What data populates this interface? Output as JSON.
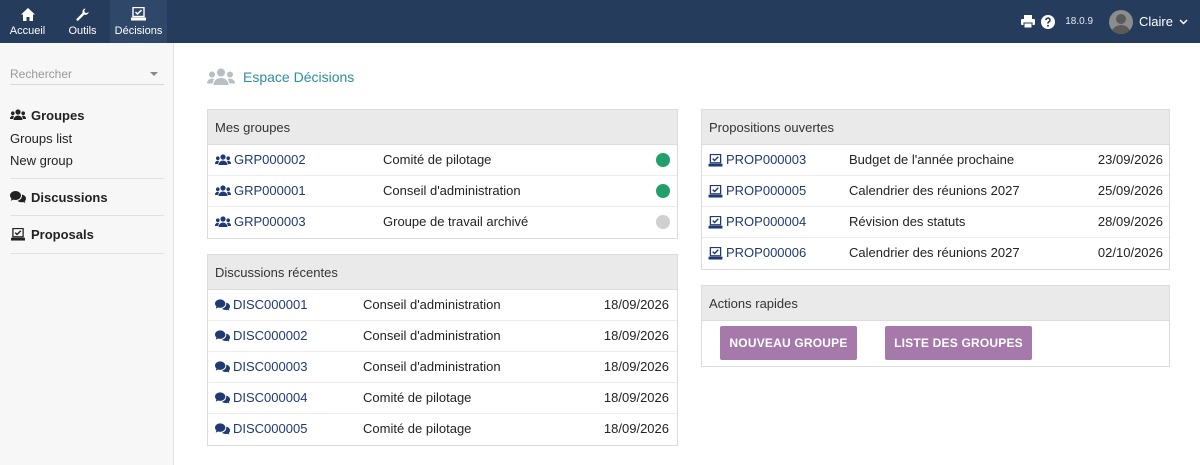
{
  "topnav": {
    "items": [
      {
        "label": "Accueil",
        "icon": "home-icon"
      },
      {
        "label": "Outils",
        "icon": "wrench-icon"
      },
      {
        "label": "Décisions",
        "icon": "vote-icon"
      }
    ],
    "version": "18.0.9",
    "user": "Claire",
    "bar_color": "#263c5c"
  },
  "sidebar": {
    "search_placeholder": "Rechercher",
    "groups_heading": "Groupes",
    "groups_items": [
      "Groups list",
      "New group"
    ],
    "discussions_heading": "Discussions",
    "proposals_heading": "Proposals"
  },
  "main": {
    "title": "Espace Décisions",
    "mes_groupes": {
      "title": "Mes groupes",
      "rows": [
        {
          "ref": "GRP000002",
          "name": "Comité de pilotage",
          "status": "active",
          "status_color": "#22a06b"
        },
        {
          "ref": "GRP000001",
          "name": "Conseil d'administration",
          "status": "active",
          "status_color": "#22a06b"
        },
        {
          "ref": "GRP000003",
          "name": "Groupe de travail archivé",
          "status": "archived",
          "status_color": "#d0d0d0"
        }
      ]
    },
    "discussions": {
      "title": "Discussions récentes",
      "rows": [
        {
          "ref": "DISC000001",
          "group": "Conseil d'administration",
          "date": "18/09/2026"
        },
        {
          "ref": "DISC000002",
          "group": "Conseil d'administration",
          "date": "18/09/2026"
        },
        {
          "ref": "DISC000003",
          "group": "Conseil d'administration",
          "date": "18/09/2026"
        },
        {
          "ref": "DISC000004",
          "group": "Comité de pilotage",
          "date": "18/09/2026"
        },
        {
          "ref": "DISC000005",
          "group": "Comité de pilotage",
          "date": "18/09/2026"
        }
      ]
    },
    "propositions": {
      "title": "Propositions ouvertes",
      "rows": [
        {
          "ref": "PROP000003",
          "label": "Budget de l'année prochaine",
          "date": "23/09/2026"
        },
        {
          "ref": "PROP000005",
          "label": "Calendrier des réunions 2027",
          "date": "25/09/2026"
        },
        {
          "ref": "PROP000004",
          "label": "Révision des statuts",
          "date": "28/09/2026"
        },
        {
          "ref": "PROP000006",
          "label": "Calendrier des réunions 2027",
          "date": "02/10/2026"
        }
      ]
    },
    "actions": {
      "title": "Actions rapides",
      "new_group": "NOUVEAU GROUPE",
      "group_list": "LISTE DES GROUPES",
      "button_color": "#a679ab"
    },
    "link_color": "#1f3a73",
    "title_color": "#2b8f9c"
  }
}
